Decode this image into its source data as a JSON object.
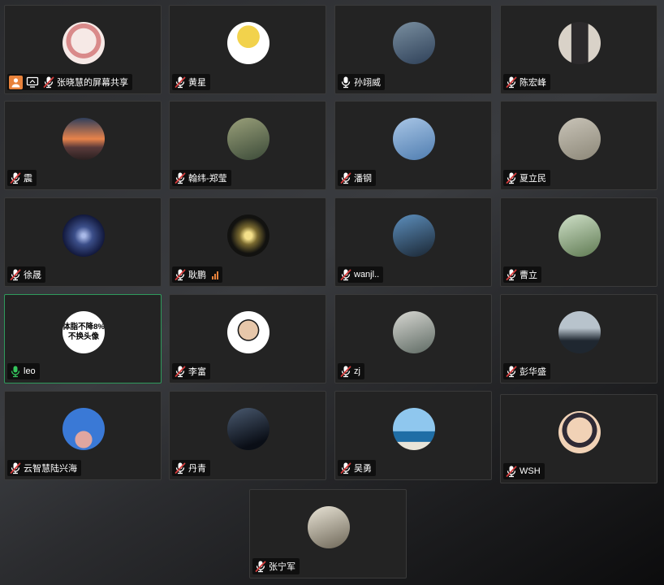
{
  "participants": [
    {
      "name": "张晓慧的屏幕共享",
      "mic": "muted",
      "sharing": true,
      "avatar": "cartoon-girl",
      "avatar_colors": [
        "#f6e9e6",
        "#d98a8a"
      ]
    },
    {
      "name": "黄星",
      "mic": "muted",
      "avatar": "yellow-tree",
      "avatar_colors": [
        "#ffffff",
        "#f2d24c"
      ]
    },
    {
      "name": "孙翊威",
      "mic": "on",
      "avatar": "person-in-alley",
      "avatar_colors": [
        "#7a8fa0",
        "#2e4058"
      ]
    },
    {
      "name": "陈宏峰",
      "mic": "muted",
      "avatar": "man-in-suit",
      "avatar_colors": [
        "#d9d2c8",
        "#2c2a2c"
      ]
    },
    {
      "name": "震",
      "mic": "muted",
      "avatar": "mountain-sunset",
      "avatar_colors": [
        "#e8834b",
        "#2f3f5c"
      ]
    },
    {
      "name": "翰纬-郑莹",
      "mic": "muted",
      "avatar": "anime-character",
      "avatar_colors": [
        "#9aa07a",
        "#3b4a38"
      ]
    },
    {
      "name": "潘钢",
      "mic": "muted",
      "avatar": "airplane-sky",
      "avatar_colors": [
        "#a9c6e6",
        "#4f7db0"
      ]
    },
    {
      "name": "夏立民",
      "mic": "muted",
      "avatar": "gallery-wall",
      "avatar_colors": [
        "#c9c4b8",
        "#8c8778"
      ]
    },
    {
      "name": "徐晟",
      "mic": "muted",
      "avatar": "galaxy",
      "avatar_colors": [
        "#3c4f8a",
        "#0d1233"
      ]
    },
    {
      "name": "耿鹏",
      "mic": "muted",
      "signal": true,
      "avatar": "tunnel-light",
      "avatar_colors": [
        "#f4e08a",
        "#121210"
      ]
    },
    {
      "name": "wanjl..",
      "mic": "muted",
      "avatar": "plant-silhouette",
      "avatar_colors": [
        "#5d8fbd",
        "#1a2633"
      ]
    },
    {
      "name": "曹立",
      "mic": "muted",
      "avatar": "willow-tree",
      "avatar_colors": [
        "#cfe0c8",
        "#5f7a52"
      ]
    },
    {
      "name": "leo",
      "mic": "active",
      "speaking": true,
      "avatar": "text-avatar",
      "avatar_text": [
        "体脂不降8%",
        "不换头像"
      ]
    },
    {
      "name": "李富",
      "mic": "muted",
      "avatar": "man-glasses",
      "avatar_colors": [
        "#e7c7aa",
        "#1a1a1a"
      ]
    },
    {
      "name": "zj",
      "mic": "muted",
      "avatar": "city-street",
      "avatar_colors": [
        "#d7d7d2",
        "#5e6a63"
      ]
    },
    {
      "name": "彭华盛",
      "mic": "muted",
      "avatar": "dark-silhouettes",
      "avatar_colors": [
        "#b8c3cc",
        "#1f2730"
      ]
    },
    {
      "name": "云智慧陆兴海",
      "mic": "muted",
      "avatar": "blue-portrait",
      "avatar_colors": [
        "#3a79d6",
        "#e0a6a0"
      ]
    },
    {
      "name": "丹青",
      "mic": "muted",
      "avatar": "night-sky",
      "avatar_colors": [
        "#4a5a70",
        "#0a0e16"
      ]
    },
    {
      "name": "吴勇",
      "mic": "muted",
      "avatar": "sea-horizon",
      "avatar_colors": [
        "#8fc7ee",
        "#1f6ea6"
      ]
    },
    {
      "name": "WSH",
      "mic": "muted",
      "avatar": "cartoon-boy",
      "avatar_colors": [
        "#f1d2b6",
        "#2f2a35"
      ]
    },
    {
      "name": "张宁军",
      "mic": "muted",
      "avatar": "coins",
      "avatar_colors": [
        "#e9e4d6",
        "#6d6657"
      ]
    }
  ],
  "colors": {
    "muted_mic": "#d53b3b",
    "active_mic": "#35c65d",
    "share_badge": "#e8823b",
    "speaking_border": "#2f9a5c"
  }
}
